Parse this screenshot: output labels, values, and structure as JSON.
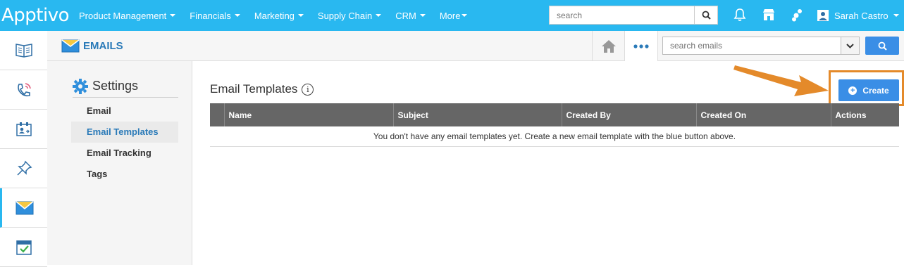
{
  "brand": "Apptivo",
  "nav": {
    "menu": [
      {
        "label": "Product Management"
      },
      {
        "label": "Financials"
      },
      {
        "label": "Marketing"
      },
      {
        "label": "Supply Chain"
      },
      {
        "label": "CRM"
      },
      {
        "label": "More"
      }
    ],
    "search_placeholder": "search",
    "user_name": "Sarah Castro"
  },
  "rail": {
    "items": [
      "book-icon",
      "phone-icon",
      "contact-card-icon",
      "pin-icon",
      "email-icon",
      "calendar-check-icon"
    ],
    "active": "email-icon"
  },
  "subheader": {
    "app_title": "EMAILS",
    "search_placeholder": "search emails"
  },
  "settings": {
    "title": "Settings",
    "links": [
      {
        "label": "Email",
        "active": false
      },
      {
        "label": "Email Templates",
        "active": true
      },
      {
        "label": "Email Tracking",
        "active": false
      },
      {
        "label": "Tags",
        "active": false
      }
    ]
  },
  "main": {
    "title": "Email Templates",
    "info_symbol": "i",
    "create_label": "Create",
    "table": {
      "columns": [
        "Name",
        "Subject",
        "Created By",
        "Created On",
        "Actions"
      ],
      "empty_message": "You don't have any email templates yet. Create a new email template with the blue button above."
    }
  },
  "colors": {
    "nav_bg": "#29b8f0",
    "accent_blue": "#3a8ee6",
    "highlight_orange": "#e48a2a",
    "table_header": "#666666"
  }
}
